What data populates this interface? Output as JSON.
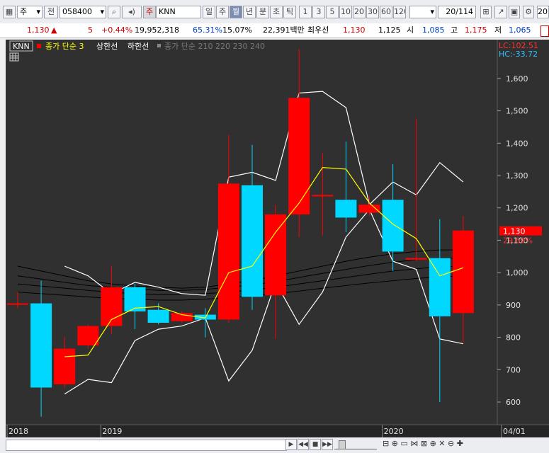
{
  "toolbar": {
    "market": "주",
    "prev_label": "전",
    "stock_code": "058400",
    "name_badge": "주",
    "stock_name": "KNN",
    "period_tabs": [
      "일",
      "주",
      "월",
      "년"
    ],
    "active_period": "월",
    "interval_tabs": [
      "분",
      "초",
      "틱"
    ],
    "num_tabs": [
      "1",
      "3",
      "5",
      "10",
      "20",
      "30",
      "60",
      "120"
    ],
    "page_counter": "20/114",
    "extra_label": "20"
  },
  "info": {
    "price": "1,130",
    "change_arrow": "▲",
    "change": "5",
    "change_pct": "+0.44%",
    "volume": "19,952,318",
    "ratio1": "65.31%",
    "ratio2": "15.07%",
    "amount": "22,391백만",
    "pref_label": "최우선",
    "pref_price": "1,130",
    "ask": "1,125",
    "open_label": "시",
    "open": "1,085",
    "high_label": "고",
    "high": "1,175",
    "low_label": "저",
    "low": "1,065"
  },
  "legend": {
    "name": "KNN",
    "ma_label": "종가 단순 3",
    "upper_label": "상한선",
    "lower_label": "하한선",
    "ma_multi_label": "종가 단순 210 220 230 240"
  },
  "right_labels": {
    "lc": "LC:102.51",
    "hc": "HC:-33.72",
    "price": "1,130",
    "pct": "29.69%"
  },
  "colors": {
    "up": "#ff0000",
    "down": "#00d8ff",
    "background": "#303030",
    "ma3": "#ffff00",
    "envelope": "#ffffff",
    "long_ma": "#000000",
    "price_tag": "#ff0000"
  },
  "bottom": {
    "controls": [
      "▶",
      "◀◀",
      "■",
      "▶▶"
    ]
  },
  "chart_data": {
    "type": "candlestick",
    "interval": "monthly",
    "ylim": [
      530,
      1720
    ],
    "yticks": [
      600,
      700,
      800,
      900,
      1000,
      1100,
      1200,
      1300,
      1400,
      1500,
      1600
    ],
    "x_labels": [
      {
        "index": 0,
        "text": "2018"
      },
      {
        "index": 4,
        "text": "2019"
      },
      {
        "index": 16,
        "text": "2020"
      },
      {
        "index": 21,
        "text": "04/01"
      }
    ],
    "candles": [
      {
        "o": 905,
        "h": 940,
        "l": 890,
        "c": 905
      },
      {
        "o": 905,
        "h": 975,
        "l": 555,
        "c": 645
      },
      {
        "o": 655,
        "h": 800,
        "l": 645,
        "c": 765
      },
      {
        "o": 775,
        "h": 840,
        "l": 765,
        "c": 835
      },
      {
        "o": 835,
        "h": 1020,
        "l": 810,
        "c": 955
      },
      {
        "o": 955,
        "h": 965,
        "l": 825,
        "c": 880
      },
      {
        "o": 885,
        "h": 905,
        "l": 840,
        "c": 845
      },
      {
        "o": 850,
        "h": 880,
        "l": 845,
        "c": 875
      },
      {
        "o": 870,
        "h": 890,
        "l": 800,
        "c": 855
      },
      {
        "o": 855,
        "h": 1425,
        "l": 845,
        "c": 1275
      },
      {
        "o": 1270,
        "h": 1395,
        "l": 885,
        "c": 925
      },
      {
        "o": 930,
        "h": 1210,
        "l": 795,
        "c": 1180
      },
      {
        "o": 1180,
        "h": 1690,
        "l": 1110,
        "c": 1540
      },
      {
        "o": 1240,
        "h": 1370,
        "l": 1115,
        "c": 1240
      },
      {
        "o": 1225,
        "h": 1405,
        "l": 1125,
        "c": 1170
      },
      {
        "o": 1185,
        "h": 1235,
        "l": 1175,
        "c": 1210
      },
      {
        "o": 1225,
        "h": 1335,
        "l": 1005,
        "c": 1065
      },
      {
        "o": 1040,
        "h": 1475,
        "l": 1035,
        "c": 1045
      },
      {
        "o": 1045,
        "h": 1165,
        "l": 600,
        "c": 865
      },
      {
        "o": 875,
        "h": 1175,
        "l": 785,
        "c": 1130
      }
    ],
    "series": [
      {
        "name": "종가 단순 3",
        "values": [
          null,
          null,
          740,
          745,
          855,
          890,
          895,
          870,
          860,
          1000,
          1020,
          1125,
          1215,
          1325,
          1320,
          1215,
          1150,
          1105,
          990,
          1015
        ]
      },
      {
        "name": "상한선",
        "values": [
          null,
          null,
          1020,
          990,
          935,
          970,
          955,
          935,
          930,
          1295,
          1310,
          1285,
          1555,
          1560,
          1510,
          1210,
          1280,
          1240,
          1340,
          1280
        ]
      },
      {
        "name": "하한선",
        "values": [
          null,
          null,
          625,
          670,
          660,
          790,
          825,
          835,
          860,
          665,
          760,
          970,
          840,
          940,
          1110,
          1195,
          1035,
          1010,
          795,
          780
        ]
      },
      {
        "name": "210",
        "values": [
          1020,
          1005,
          990,
          975,
          965,
          958,
          955,
          952,
          955,
          965,
          975,
          990,
          1005,
          1020,
          1035,
          1048,
          1058,
          1065,
          1070,
          1070
        ]
      },
      {
        "name": "220",
        "values": [
          990,
          980,
          970,
          960,
          955,
          950,
          945,
          945,
          948,
          955,
          962,
          972,
          985,
          998,
          1010,
          1022,
          1032,
          1040,
          1045,
          1045
        ]
      },
      {
        "name": "230",
        "values": [
          965,
          958,
          952,
          945,
          940,
          935,
          932,
          932,
          935,
          940,
          946,
          955,
          965,
          975,
          985,
          995,
          1005,
          1012,
          1018,
          1020
        ]
      },
      {
        "name": "240",
        "values": [
          940,
          935,
          930,
          925,
          920,
          918,
          915,
          915,
          918,
          922,
          928,
          935,
          943,
          952,
          960,
          968,
          975,
          982,
          987,
          990
        ]
      }
    ]
  }
}
